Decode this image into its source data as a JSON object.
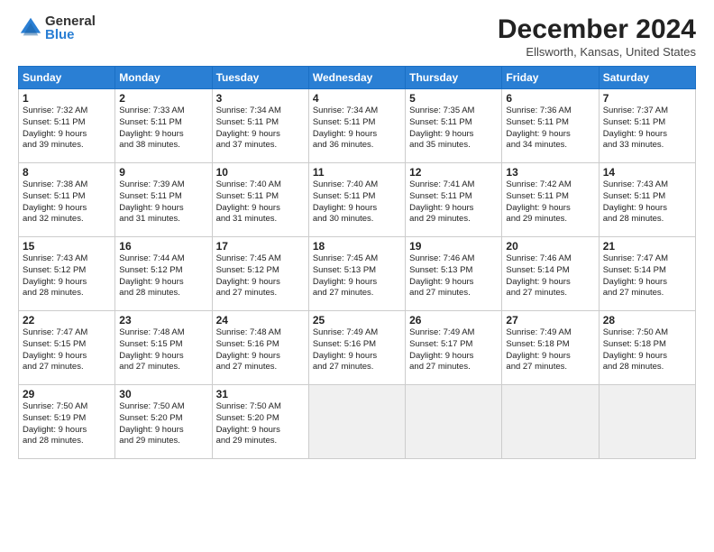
{
  "logo": {
    "general": "General",
    "blue": "Blue"
  },
  "title": "December 2024",
  "location": "Ellsworth, Kansas, United States",
  "headers": [
    "Sunday",
    "Monday",
    "Tuesday",
    "Wednesday",
    "Thursday",
    "Friday",
    "Saturday"
  ],
  "days": [
    {
      "num": "",
      "info": "",
      "empty": true
    },
    {
      "num": "",
      "info": "",
      "empty": true
    },
    {
      "num": "",
      "info": "",
      "empty": true
    },
    {
      "num": "",
      "info": "",
      "empty": true
    },
    {
      "num": "",
      "info": "",
      "empty": true
    },
    {
      "num": "",
      "info": "",
      "empty": true
    },
    {
      "num": "7",
      "info": "Sunrise: 7:37 AM\nSunset: 5:11 PM\nDaylight: 9 hours\nand 33 minutes.",
      "empty": false
    },
    {
      "num": "1",
      "info": "Sunrise: 7:32 AM\nSunset: 5:11 PM\nDaylight: 9 hours\nand 39 minutes.",
      "empty": false
    },
    {
      "num": "2",
      "info": "Sunrise: 7:33 AM\nSunset: 5:11 PM\nDaylight: 9 hours\nand 38 minutes.",
      "empty": false
    },
    {
      "num": "3",
      "info": "Sunrise: 7:34 AM\nSunset: 5:11 PM\nDaylight: 9 hours\nand 37 minutes.",
      "empty": false
    },
    {
      "num": "4",
      "info": "Sunrise: 7:34 AM\nSunset: 5:11 PM\nDaylight: 9 hours\nand 36 minutes.",
      "empty": false
    },
    {
      "num": "5",
      "info": "Sunrise: 7:35 AM\nSunset: 5:11 PM\nDaylight: 9 hours\nand 35 minutes.",
      "empty": false
    },
    {
      "num": "6",
      "info": "Sunrise: 7:36 AM\nSunset: 5:11 PM\nDaylight: 9 hours\nand 34 minutes.",
      "empty": false
    },
    {
      "num": "8",
      "info": "Sunrise: 7:38 AM\nSunset: 5:11 PM\nDaylight: 9 hours\nand 32 minutes.",
      "empty": false
    },
    {
      "num": "9",
      "info": "Sunrise: 7:39 AM\nSunset: 5:11 PM\nDaylight: 9 hours\nand 31 minutes.",
      "empty": false
    },
    {
      "num": "10",
      "info": "Sunrise: 7:40 AM\nSunset: 5:11 PM\nDaylight: 9 hours\nand 31 minutes.",
      "empty": false
    },
    {
      "num": "11",
      "info": "Sunrise: 7:40 AM\nSunset: 5:11 PM\nDaylight: 9 hours\nand 30 minutes.",
      "empty": false
    },
    {
      "num": "12",
      "info": "Sunrise: 7:41 AM\nSunset: 5:11 PM\nDaylight: 9 hours\nand 29 minutes.",
      "empty": false
    },
    {
      "num": "13",
      "info": "Sunrise: 7:42 AM\nSunset: 5:11 PM\nDaylight: 9 hours\nand 29 minutes.",
      "empty": false
    },
    {
      "num": "14",
      "info": "Sunrise: 7:43 AM\nSunset: 5:11 PM\nDaylight: 9 hours\nand 28 minutes.",
      "empty": false
    },
    {
      "num": "15",
      "info": "Sunrise: 7:43 AM\nSunset: 5:12 PM\nDaylight: 9 hours\nand 28 minutes.",
      "empty": false
    },
    {
      "num": "16",
      "info": "Sunrise: 7:44 AM\nSunset: 5:12 PM\nDaylight: 9 hours\nand 28 minutes.",
      "empty": false
    },
    {
      "num": "17",
      "info": "Sunrise: 7:45 AM\nSunset: 5:12 PM\nDaylight: 9 hours\nand 27 minutes.",
      "empty": false
    },
    {
      "num": "18",
      "info": "Sunrise: 7:45 AM\nSunset: 5:13 PM\nDaylight: 9 hours\nand 27 minutes.",
      "empty": false
    },
    {
      "num": "19",
      "info": "Sunrise: 7:46 AM\nSunset: 5:13 PM\nDaylight: 9 hours\nand 27 minutes.",
      "empty": false
    },
    {
      "num": "20",
      "info": "Sunrise: 7:46 AM\nSunset: 5:14 PM\nDaylight: 9 hours\nand 27 minutes.",
      "empty": false
    },
    {
      "num": "21",
      "info": "Sunrise: 7:47 AM\nSunset: 5:14 PM\nDaylight: 9 hours\nand 27 minutes.",
      "empty": false
    },
    {
      "num": "22",
      "info": "Sunrise: 7:47 AM\nSunset: 5:15 PM\nDaylight: 9 hours\nand 27 minutes.",
      "empty": false
    },
    {
      "num": "23",
      "info": "Sunrise: 7:48 AM\nSunset: 5:15 PM\nDaylight: 9 hours\nand 27 minutes.",
      "empty": false
    },
    {
      "num": "24",
      "info": "Sunrise: 7:48 AM\nSunset: 5:16 PM\nDaylight: 9 hours\nand 27 minutes.",
      "empty": false
    },
    {
      "num": "25",
      "info": "Sunrise: 7:49 AM\nSunset: 5:16 PM\nDaylight: 9 hours\nand 27 minutes.",
      "empty": false
    },
    {
      "num": "26",
      "info": "Sunrise: 7:49 AM\nSunset: 5:17 PM\nDaylight: 9 hours\nand 27 minutes.",
      "empty": false
    },
    {
      "num": "27",
      "info": "Sunrise: 7:49 AM\nSunset: 5:18 PM\nDaylight: 9 hours\nand 27 minutes.",
      "empty": false
    },
    {
      "num": "28",
      "info": "Sunrise: 7:50 AM\nSunset: 5:18 PM\nDaylight: 9 hours\nand 28 minutes.",
      "empty": false
    },
    {
      "num": "29",
      "info": "Sunrise: 7:50 AM\nSunset: 5:19 PM\nDaylight: 9 hours\nand 28 minutes.",
      "empty": false
    },
    {
      "num": "30",
      "info": "Sunrise: 7:50 AM\nSunset: 5:20 PM\nDaylight: 9 hours\nand 29 minutes.",
      "empty": false
    },
    {
      "num": "31",
      "info": "Sunrise: 7:50 AM\nSunset: 5:20 PM\nDaylight: 9 hours\nand 29 minutes.",
      "empty": false
    },
    {
      "num": "",
      "info": "",
      "empty": true
    },
    {
      "num": "",
      "info": "",
      "empty": true
    },
    {
      "num": "",
      "info": "",
      "empty": true
    },
    {
      "num": "",
      "info": "",
      "empty": true
    }
  ]
}
